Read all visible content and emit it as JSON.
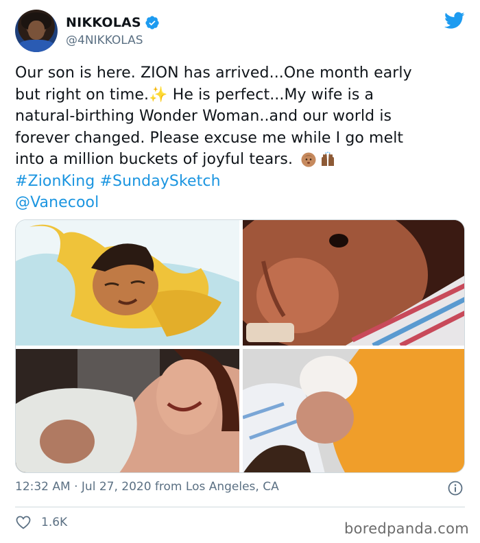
{
  "author": {
    "display_name": "NIKKOLAS",
    "handle": "@4NIKKOLAS",
    "verified": true
  },
  "tweet": {
    "lines": [
      "Our son is here. ZION has arrived...One month early",
      "but right on time.",
      " He is perfect...My wife is a",
      "natural-birthing Wonder Woman..and our world is",
      "forever changed.  Please excuse me while I go melt",
      "into a million buckets of joyful tears."
    ],
    "hashtags": [
      "#ZionKing",
      "#SundaySketch"
    ],
    "mention": "@Vanecool",
    "emojis": [
      "sparkles-icon",
      "baby-face-icon",
      "raised-hands-icon"
    ]
  },
  "media": {
    "images": [
      {
        "name": "sketch-baby-yellow-blanket"
      },
      {
        "name": "newborn-closeup-striped-blanket"
      },
      {
        "name": "mother-holding-newborn"
      },
      {
        "name": "newborn-on-chest-orange-shirt"
      }
    ]
  },
  "meta": {
    "timestamp": "12:32 AM · Jul 27, 2020 from Los Angeles, CA",
    "like_count": "1.6K"
  },
  "watermark": "boredpanda.com",
  "colors": {
    "brand_blue": "#1d9bf0",
    "link": "#1b95e0",
    "secondary_text": "#5b7083",
    "border": "#cfd9de"
  }
}
